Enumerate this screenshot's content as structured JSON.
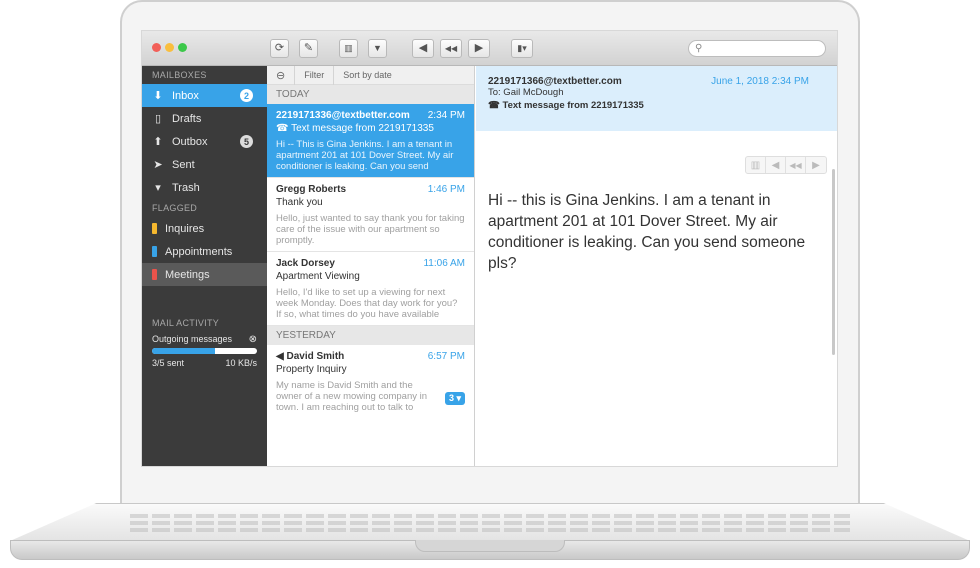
{
  "window": {
    "traffic_lights": [
      "#f25f58",
      "#f9be3e",
      "#3cc84a"
    ],
    "toolbar": {
      "buttons": [
        {
          "name": "refresh-icon",
          "glyph": "⟳"
        },
        {
          "name": "compose-icon",
          "glyph": "✎"
        },
        {
          "name": "trash-icon",
          "glyph": "🗑"
        },
        {
          "name": "thumbs-down-icon",
          "glyph": "✋"
        },
        {
          "name": "reply-icon",
          "glyph": "◀"
        },
        {
          "name": "reply-all-icon",
          "glyph": "◀◀"
        },
        {
          "name": "forward-icon",
          "glyph": "▶"
        },
        {
          "name": "bookmark-icon",
          "glyph": "▮▾"
        }
      ],
      "search_placeholder": ""
    }
  },
  "sidebar": {
    "mailboxes_heading": "MAILBOXES",
    "items": [
      {
        "label": "Inbox",
        "icon": "inbox-icon",
        "glyph": "⬇",
        "badge": "2"
      },
      {
        "label": "Drafts",
        "icon": "document-icon",
        "glyph": "▯",
        "badge": ""
      },
      {
        "label": "Outbox",
        "icon": "outbox-icon",
        "glyph": "⬆",
        "badge": "5"
      },
      {
        "label": "Sent",
        "icon": "paper-plane-icon",
        "glyph": "➤",
        "badge": ""
      },
      {
        "label": "Trash",
        "icon": "trash-icon",
        "glyph": "▾",
        "badge": ""
      }
    ],
    "flagged_heading": "FLAGGED",
    "flagged": [
      {
        "label": "Inquires",
        "color": "#f5b82e"
      },
      {
        "label": "Appointments",
        "color": "#38a3e8"
      },
      {
        "label": "Meetings",
        "color": "#e9534b"
      }
    ],
    "activity": {
      "heading": "MAIL ACTIVITY",
      "label": "Outgoing messages",
      "progress": 0.6,
      "sent": "3/5 sent",
      "rate": "10 KB/s"
    }
  },
  "list": {
    "tools": {
      "filter": "Filter",
      "sort": "Sort by date"
    },
    "groups": [
      {
        "label": "TODAY",
        "messages": [
          {
            "from": "2219171336@textbetter.com",
            "time": "2:34 PM",
            "subject": "Text message from 2219171335",
            "preview": "Hi -- This is Gina Jenkins. I am a tenant in apartment 201 at 101 Dover Street. My air conditioner is leaking. Can you send"
          },
          {
            "from": "Gregg Roberts",
            "time": "1:46 PM",
            "subject": "Thank you",
            "preview": "Hello, just wanted to say thank you for taking care of the issue with our apartment so promptly."
          },
          {
            "from": "Jack Dorsey",
            "time": "11:06 AM",
            "subject": "Apartment Viewing",
            "preview": "Hello, I'd like to set up a viewing for next week Monday. Does that day work for you? If so, what times do you have available"
          }
        ]
      },
      {
        "label": "YESTERDAY",
        "messages": [
          {
            "from": "David Smith",
            "time": "6:57 PM",
            "subject": "Property Inquiry",
            "preview": "My name is David Smith and the owner of a new mowing company in town. I am reaching out to talk to",
            "count": "3 ▾"
          }
        ]
      }
    ]
  },
  "reader": {
    "from": "2219171366@textbetter.com",
    "date": "June 1, 2018 2:34 PM",
    "to": "To: Gail McDough",
    "subject": "Text message from 2219171335",
    "body": "Hi -- this is Gina Jenkins. I am a tenant in apartment 201 at 101 Dover Street. My air conditioner is leaking. Can you send someone pls?"
  }
}
